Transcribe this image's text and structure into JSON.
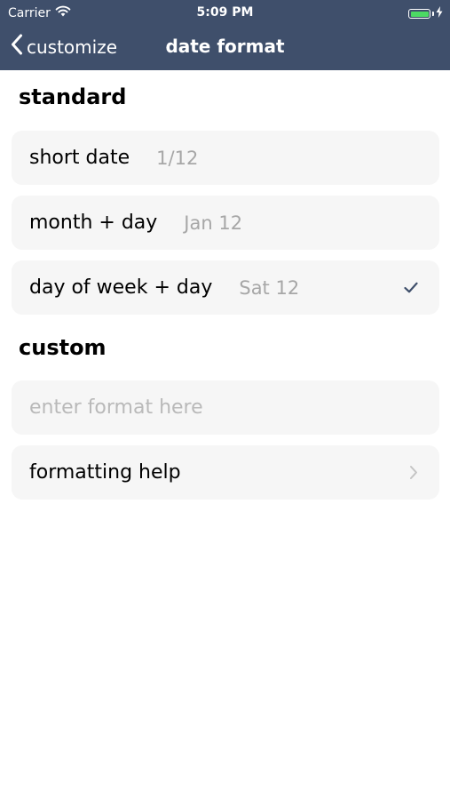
{
  "status_bar": {
    "carrier": "Carrier",
    "time": "5:09 PM"
  },
  "nav": {
    "back_label": "customize",
    "title": "date format"
  },
  "sections": {
    "standard": {
      "title": "standard",
      "rows": [
        {
          "label": "short date",
          "sample": "1/12",
          "selected": false
        },
        {
          "label": "month + day",
          "sample": "Jan 12",
          "selected": false
        },
        {
          "label": "day of week + day",
          "sample": "Sat 12",
          "selected": true
        }
      ]
    },
    "custom": {
      "title": "custom",
      "input_placeholder": "enter format here",
      "input_value": "",
      "help_label": "formatting help"
    }
  },
  "colors": {
    "nav_background": "#3f4f6b",
    "row_background": "#f6f6f6",
    "sample_text": "#a7a7a7",
    "checkmark": "#3f4f6b",
    "battery_fill": "#4cd964"
  },
  "icons": {
    "wifi": "wifi-icon",
    "battery": "battery-icon",
    "charging": "charging-bolt-icon",
    "back": "chevron-left-icon",
    "check": "checkmark-icon",
    "disclosure": "chevron-right-icon"
  }
}
